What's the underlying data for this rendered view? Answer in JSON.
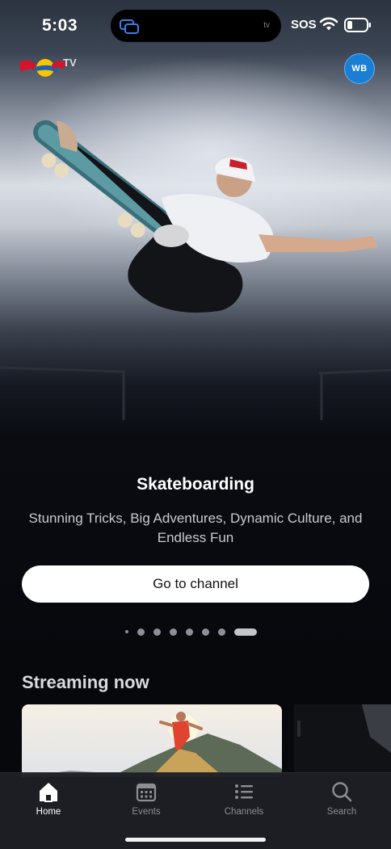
{
  "status_bar": {
    "time": "5:03",
    "island_label": "tv",
    "carrier": "SOS",
    "icons": [
      "screen-mirror-icon",
      "wifi-icon",
      "battery-icon"
    ]
  },
  "header": {
    "logo_text": "TV",
    "avatar_initials": "WB",
    "colors": {
      "avatar": "#1a7fd4"
    }
  },
  "hero": {
    "title": "Skateboarding",
    "subtitle": "Stunning Tricks, Big Adventures, Dynamic Culture, and Endless Fun",
    "cta_label": "Go to channel",
    "carousel": {
      "count": 8,
      "active_index": 7
    }
  },
  "streaming": {
    "title": "Streaming now"
  },
  "tabbar": {
    "items": [
      {
        "label": "Home",
        "icon": "home-icon",
        "active": true
      },
      {
        "label": "Events",
        "icon": "calendar-icon",
        "active": false
      },
      {
        "label": "Channels",
        "icon": "list-icon",
        "active": false
      },
      {
        "label": "Search",
        "icon": "search-icon",
        "active": false
      }
    ]
  }
}
